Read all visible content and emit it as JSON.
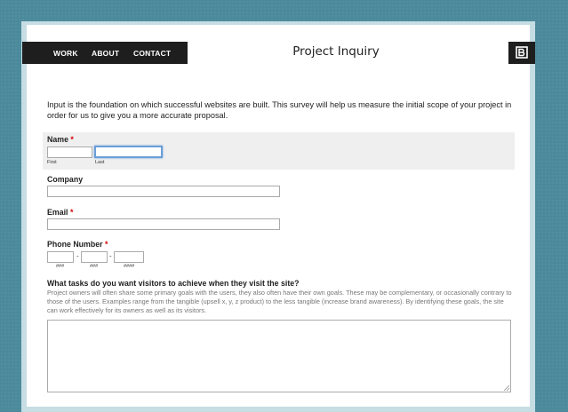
{
  "nav": {
    "items": [
      {
        "label": "WORK"
      },
      {
        "label": "ABOUT"
      },
      {
        "label": "CONTACT"
      }
    ]
  },
  "page": {
    "title": "Project Inquiry",
    "logo_icon": "brand-b-icon"
  },
  "intro": "Input is the foundation on which successful websites are built. This survey will help us measure the initial scope of your project in order for us to give you a more accurate proposal.",
  "form": {
    "name": {
      "label": "Name",
      "required_mark": "*",
      "first_sub": "First",
      "last_sub": "Last",
      "first_value": "",
      "last_value": ""
    },
    "company": {
      "label": "Company",
      "value": ""
    },
    "email": {
      "label": "Email",
      "required_mark": "*",
      "value": ""
    },
    "phone": {
      "label": "Phone Number",
      "required_mark": "*",
      "sep1": "-",
      "sep2": "-",
      "sub1": "###",
      "sub2": "###",
      "sub3": "####"
    },
    "tasks": {
      "label": "What tasks do you want visitors to achieve when they visit the site?",
      "description": "Project owners will often share some primary goals with the users, they also often have their own goals. These may be complementary, or occasionally contrary to those of the users. Examples range from the tangible (upsell x, y, z product) to the less tangible (increase brand awareness). By identifying these goals, the site can work effectively for its owners as well as its visitors.",
      "value": ""
    }
  },
  "colors": {
    "background": "#4b8a9b",
    "nav_bg": "#1e1e1e",
    "required": "#d40000",
    "focus": "#6a9ed8"
  }
}
